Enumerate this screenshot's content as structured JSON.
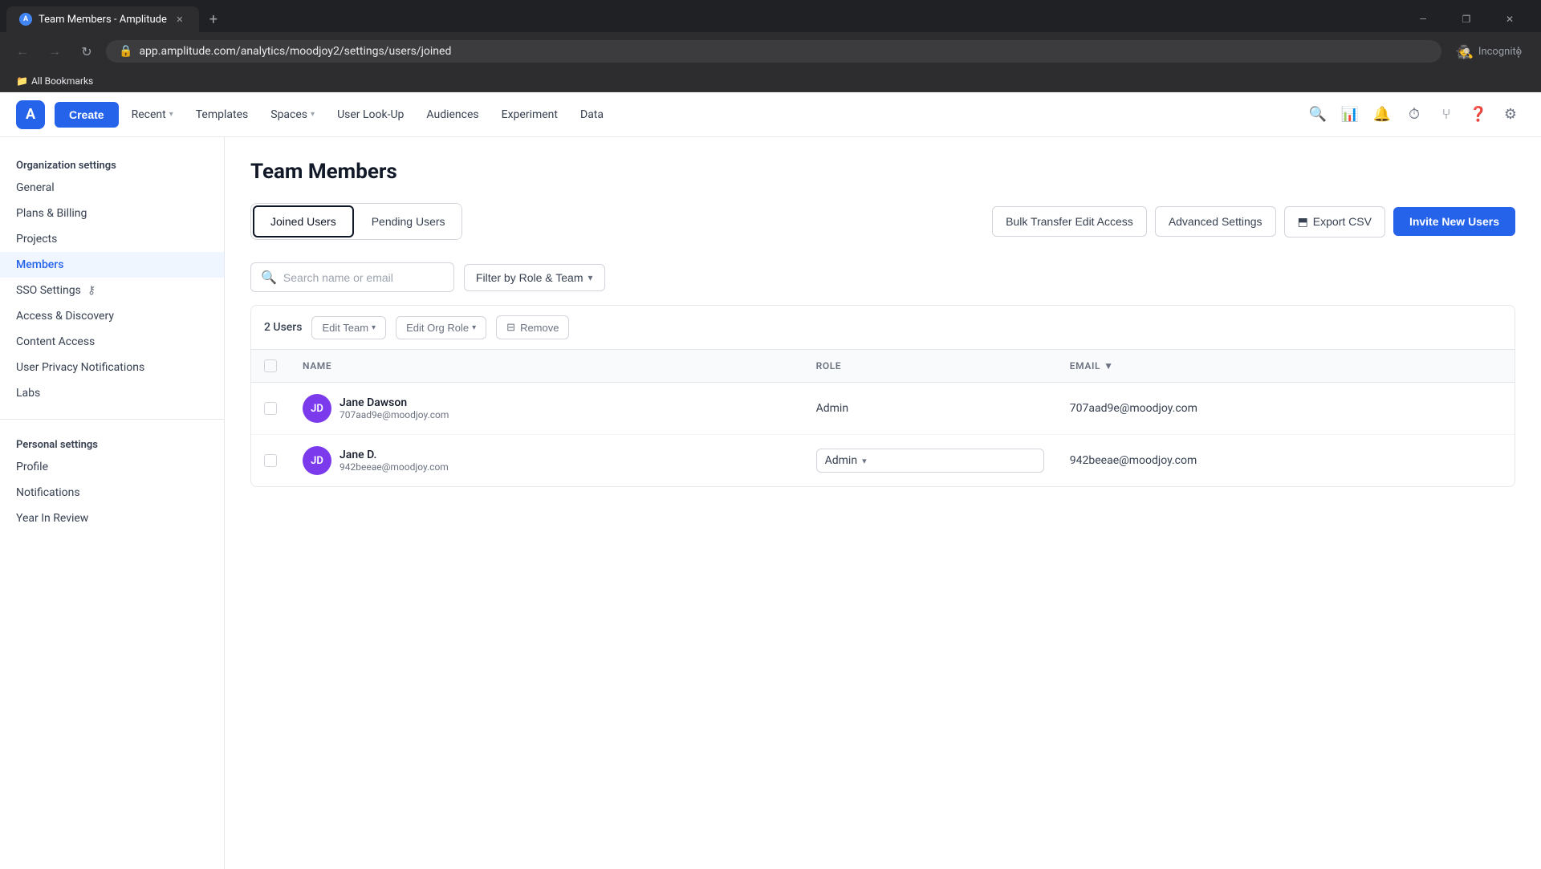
{
  "browser": {
    "tab_title": "Team Members - Amplitude",
    "tab_favicon": "A",
    "url": "app.amplitude.com/analytics/moodjoy2/settings/users/joined",
    "new_tab_symbol": "+",
    "window_controls": {
      "minimize": "—",
      "maximize": "❐",
      "close": "✕"
    },
    "nav": {
      "back": "←",
      "forward": "→",
      "reload": "↻"
    },
    "incognito_label": "Incognito",
    "bookmarks_bar_label": "All Bookmarks"
  },
  "app": {
    "logo_letter": "A",
    "create_label": "Create",
    "nav_items": [
      {
        "label": "Recent",
        "has_chevron": true
      },
      {
        "label": "Templates",
        "has_chevron": false
      },
      {
        "label": "Spaces",
        "has_chevron": true
      },
      {
        "label": "User Look-Up",
        "has_chevron": false
      },
      {
        "label": "Audiences",
        "has_chevron": false
      },
      {
        "label": "Experiment",
        "has_chevron": false
      },
      {
        "label": "Data",
        "has_chevron": false
      }
    ]
  },
  "sidebar": {
    "org_section_title": "Organization settings",
    "org_items": [
      {
        "label": "General",
        "active": false
      },
      {
        "label": "Plans & Billing",
        "active": false
      },
      {
        "label": "Projects",
        "active": false
      },
      {
        "label": "Members",
        "active": true
      },
      {
        "label": "SSO Settings",
        "active": false,
        "has_icon": true
      },
      {
        "label": "Access & Discovery",
        "active": false
      },
      {
        "label": "Content Access",
        "active": false
      },
      {
        "label": "User Privacy Notifications",
        "active": false
      },
      {
        "label": "Labs",
        "active": false
      }
    ],
    "personal_section_title": "Personal settings",
    "personal_items": [
      {
        "label": "Profile",
        "active": false
      },
      {
        "label": "Notifications",
        "active": false
      },
      {
        "label": "Year In Review",
        "active": false
      }
    ]
  },
  "content": {
    "page_title": "Team Members",
    "tabs": [
      {
        "label": "Joined Users",
        "active": true
      },
      {
        "label": "Pending Users",
        "active": false
      }
    ],
    "action_buttons": {
      "bulk_transfer": "Bulk Transfer Edit Access",
      "advanced_settings": "Advanced Settings",
      "export_csv": "Export CSV",
      "invite_new_users": "Invite New Users",
      "export_icon": "⬒"
    },
    "search": {
      "placeholder": "Search name or email",
      "icon": "🔍"
    },
    "filter": {
      "label": "Filter by Role & Team",
      "chevron": "▾"
    },
    "table": {
      "toolbar": {
        "users_count": "2 Users",
        "edit_team_label": "Edit Team",
        "edit_org_role_label": "Edit Org Role",
        "remove_label": "Remove",
        "remove_icon": "⊟"
      },
      "columns": [
        {
          "key": "name",
          "label": "NAME"
        },
        {
          "key": "role",
          "label": "ROLE"
        },
        {
          "key": "email",
          "label": "EMAIL",
          "sortable": true
        }
      ],
      "rows": [
        {
          "id": 1,
          "avatar_initials": "JD",
          "avatar_color": "#7c3aed",
          "name": "Jane Dawson",
          "email_sub": "707aad9e@moodjoy.com",
          "role": "Admin",
          "role_editable": false,
          "email": "707aad9e@moodjoy.com"
        },
        {
          "id": 2,
          "avatar_initials": "JD",
          "avatar_color": "#7c3aed",
          "name": "Jane D.",
          "email_sub": "942beeae@moodjoy.com",
          "role": "Admin",
          "role_editable": true,
          "email": "942beeae@moodjoy.com"
        }
      ]
    }
  }
}
